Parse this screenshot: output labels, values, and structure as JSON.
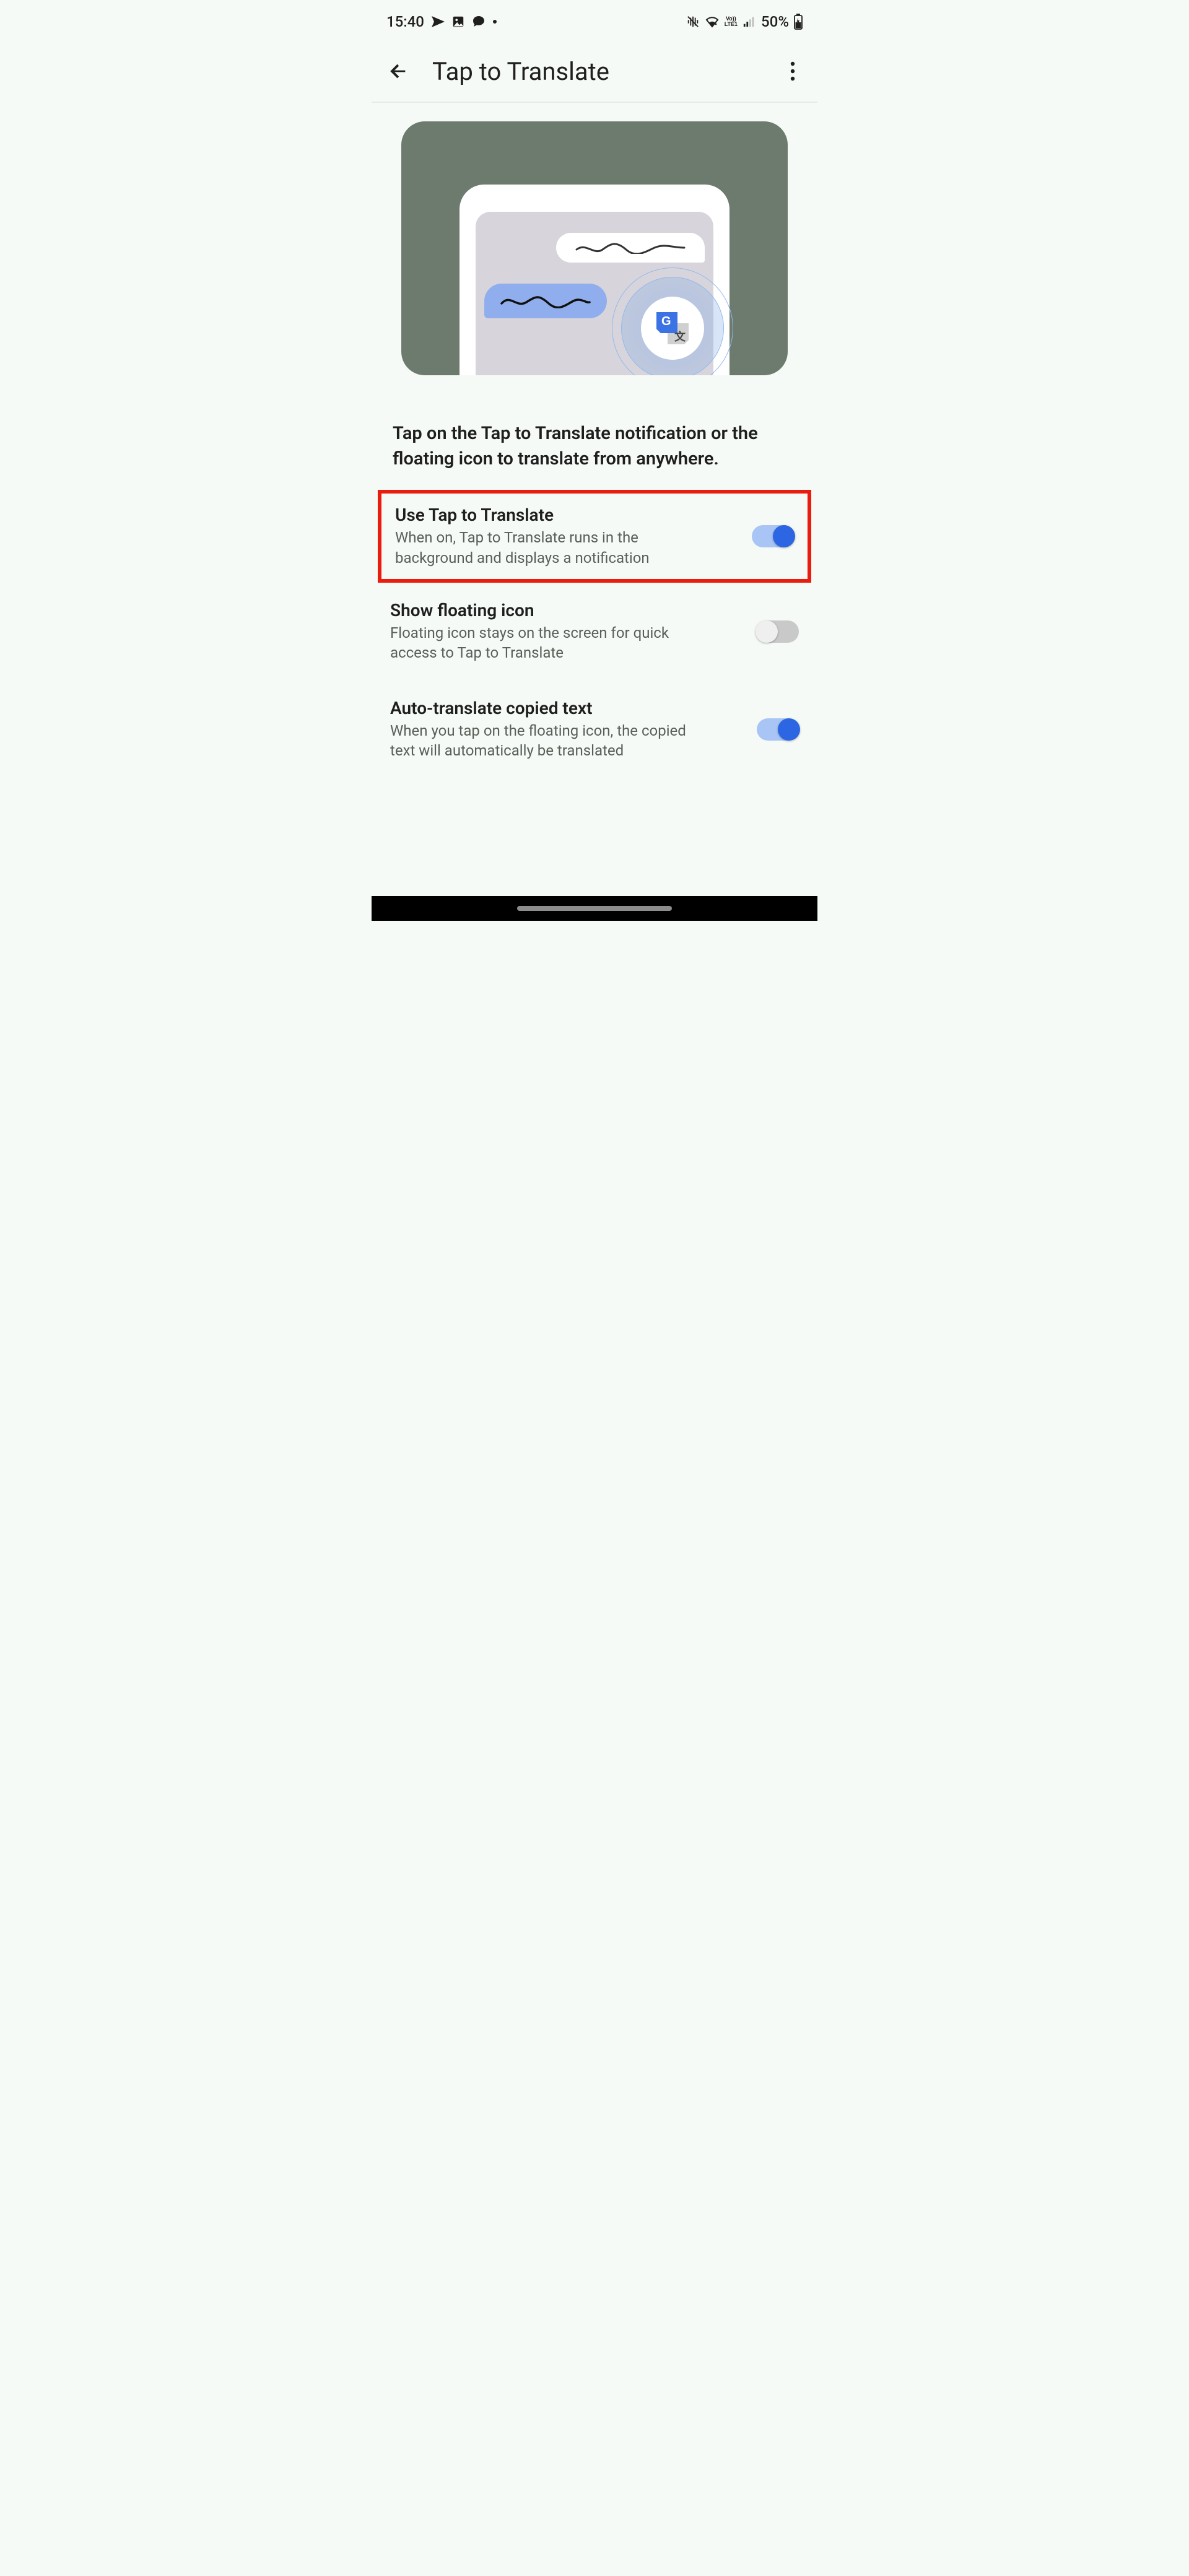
{
  "status": {
    "time": "15:40",
    "battery_pct": "50%"
  },
  "header": {
    "title": "Tap to Translate"
  },
  "description": "Tap on the Tap to Translate notification or the floating icon to translate from anywhere.",
  "settings": [
    {
      "title": "Use Tap to Translate",
      "subtitle": "When on, Tap to Translate runs in the background and displays a notification",
      "toggle": "on",
      "highlight": true
    },
    {
      "title": "Show floating icon",
      "subtitle": "Floating icon stays on the screen for quick access to Tap to Translate",
      "toggle": "off",
      "highlight": false
    },
    {
      "title": "Auto-translate copied text",
      "subtitle": "When you tap on the floating icon, the copied text will automatically be translated",
      "toggle": "on",
      "highlight": false
    }
  ]
}
